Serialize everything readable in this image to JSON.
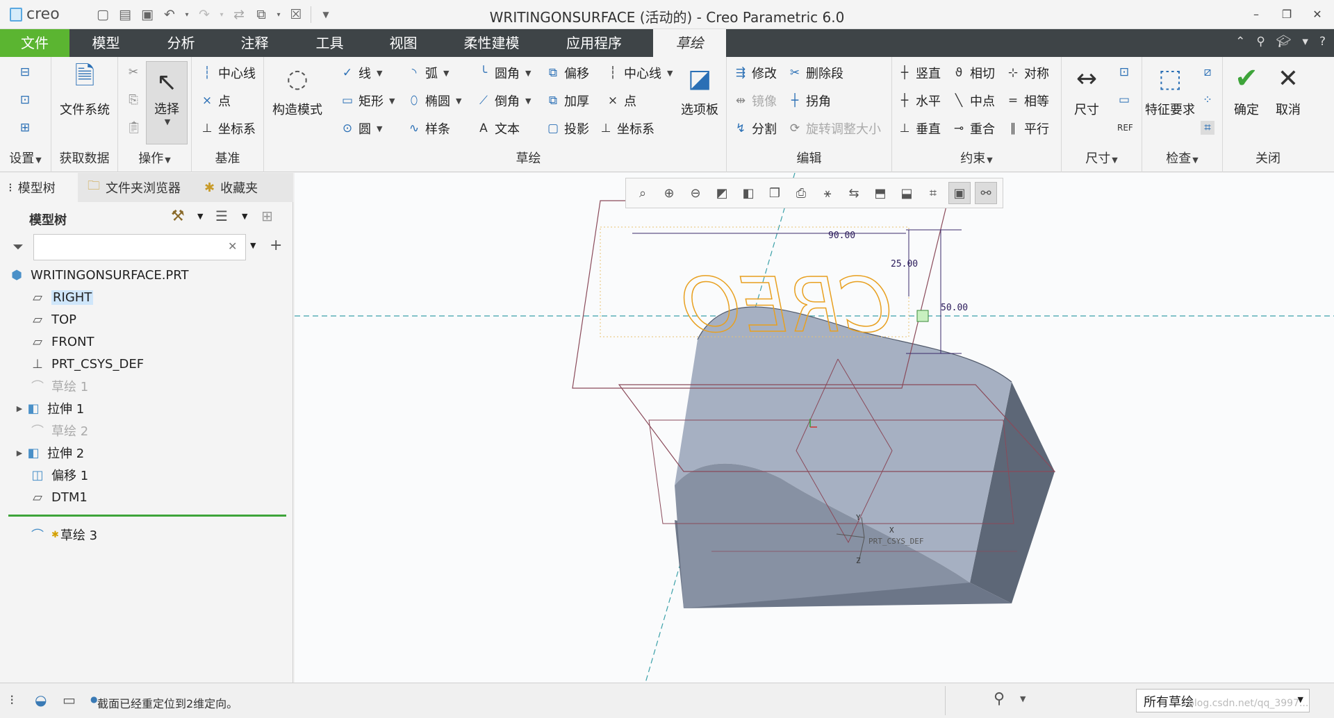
{
  "app": {
    "logo": "creo",
    "window_title": "WRITINGONSURFACE (活动的) - Creo Parametric 6.0"
  },
  "tabs": [
    {
      "label": "文件"
    },
    {
      "label": "模型"
    },
    {
      "label": "分析"
    },
    {
      "label": "注释"
    },
    {
      "label": "工具"
    },
    {
      "label": "视图"
    },
    {
      "label": "柔性建模"
    },
    {
      "label": "应用程序"
    },
    {
      "label": "草绘"
    }
  ],
  "ribbon": {
    "setup": {
      "label": "设置"
    },
    "getdata": {
      "label": "获取数据",
      "file_system": "文件系统"
    },
    "operations": {
      "label": "操作",
      "select": "选择"
    },
    "datum": {
      "label": "基准",
      "centerline": "中心线",
      "point": "点",
      "csys": "坐标系"
    },
    "construction": {
      "mode": "构造模式"
    },
    "sketch": {
      "label": "草绘",
      "line": "线",
      "arc": "弧",
      "fillet": "圆角",
      "offset": "偏移",
      "centerline": "中心线",
      "rectangle": "矩形",
      "ellipse": "椭圆",
      "chamfer": "倒角",
      "thicken": "加厚",
      "point": "点",
      "circle": "圆",
      "spline": "样条",
      "text": "文本",
      "project": "投影",
      "csys": "坐标系",
      "palette": "选项板"
    },
    "edit": {
      "label": "编辑",
      "modify": "修改",
      "delete_segment": "删除段",
      "mirror": "镜像",
      "corner": "拐角",
      "divide": "分割",
      "rotate_resize": "旋转调整大小"
    },
    "constrain": {
      "label": "约束",
      "vertical": "竖直",
      "tangent": "相切",
      "symmetric": "对称",
      "horizontal": "水平",
      "midpoint": "中点",
      "equal": "相等",
      "perpendicular": "垂直",
      "coincident": "重合",
      "parallel": "平行"
    },
    "dimension": {
      "label": "尺寸",
      "dimension": "尺寸"
    },
    "inspect": {
      "label": "检查",
      "feature_requirements": "特征要求"
    },
    "close": {
      "label": "关闭",
      "ok": "确定",
      "cancel": "取消"
    }
  },
  "navigator": {
    "tabs": [
      "模型树",
      "文件夹浏览器",
      "收藏夹"
    ],
    "tree_title": "模型树",
    "filter_placeholder": "",
    "items": [
      {
        "label": "WRITINGONSURFACE.PRT",
        "icon": "part-icon"
      },
      {
        "label": "RIGHT",
        "icon": "datum-plane-icon",
        "selected": true
      },
      {
        "label": "TOP",
        "icon": "datum-plane-icon"
      },
      {
        "label": "FRONT",
        "icon": "datum-plane-icon"
      },
      {
        "label": "PRT_CSYS_DEF",
        "icon": "csys-icon"
      },
      {
        "label": "草绘 1",
        "icon": "sketch-icon",
        "dim": true
      },
      {
        "label": "拉伸 1",
        "icon": "extrude-icon",
        "expandable": true
      },
      {
        "label": "草绘 2",
        "icon": "sketch-icon",
        "dim": true
      },
      {
        "label": "拉伸 2",
        "icon": "extrude-icon",
        "expandable": true
      },
      {
        "label": "偏移 1",
        "icon": "offset-icon"
      },
      {
        "label": "DTM1",
        "icon": "datum-plane-icon"
      }
    ],
    "active_sketch": "草绘 3"
  },
  "graphics": {
    "sketch_text": "CREO",
    "dim_90": "90.00",
    "dim_25": "25.00",
    "dim_50": "50.00",
    "csys_label": "PRT_CSYS_DEF",
    "axis_x": "X",
    "axis_y": "Y",
    "axis_z": "Z"
  },
  "status": {
    "message": "截面已经重定位到2维定向。",
    "filter": "所有草绘",
    "watermark": "blog.csdn.net/qq_3997..."
  },
  "colors": {
    "file_tab": "#5bb531",
    "tab_bar": "#3e4447",
    "sketch_text": "#e8a020",
    "surface": "#7d8898"
  }
}
